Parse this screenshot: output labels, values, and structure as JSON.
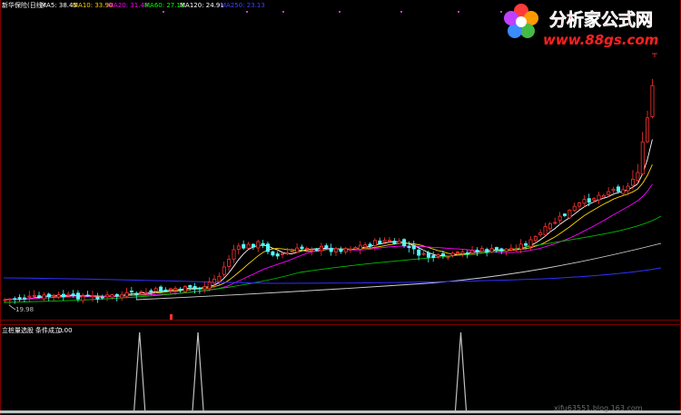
{
  "header": {
    "title": "新华保险(日线)",
    "ma_items": [
      {
        "name": "MA5",
        "value": "38.45",
        "color": "#ffffff"
      },
      {
        "name": "MA10",
        "value": "33.90",
        "color": "#ffd400"
      },
      {
        "name": "MA20",
        "value": "31.48",
        "color": "#ff00ff"
      },
      {
        "name": "MA60",
        "value": "27.11",
        "color": "#00ff00"
      },
      {
        "name": "MA120",
        "value": "24.91",
        "color": "#ffffff"
      },
      {
        "name": "MA250",
        "value": "23.13",
        "color": "#4040ff"
      }
    ]
  },
  "watermark": {
    "title": "分析家公式网",
    "url": "www.88gs.com"
  },
  "price_labels": {
    "low": "19.98"
  },
  "indicator": {
    "name": "立桩量选股",
    "cond_label": "条件成立:",
    "cond_value": "0.00"
  },
  "footer_text": "xifu63551.blog.163.com",
  "colors": {
    "up": "#ff3232",
    "down": "#54fcfc",
    "grid": "#800000",
    "signal": "#c0c0c0"
  },
  "chart_data": {
    "type": "candlestick",
    "signal_days": [
      27,
      39,
      93
    ]
  }
}
